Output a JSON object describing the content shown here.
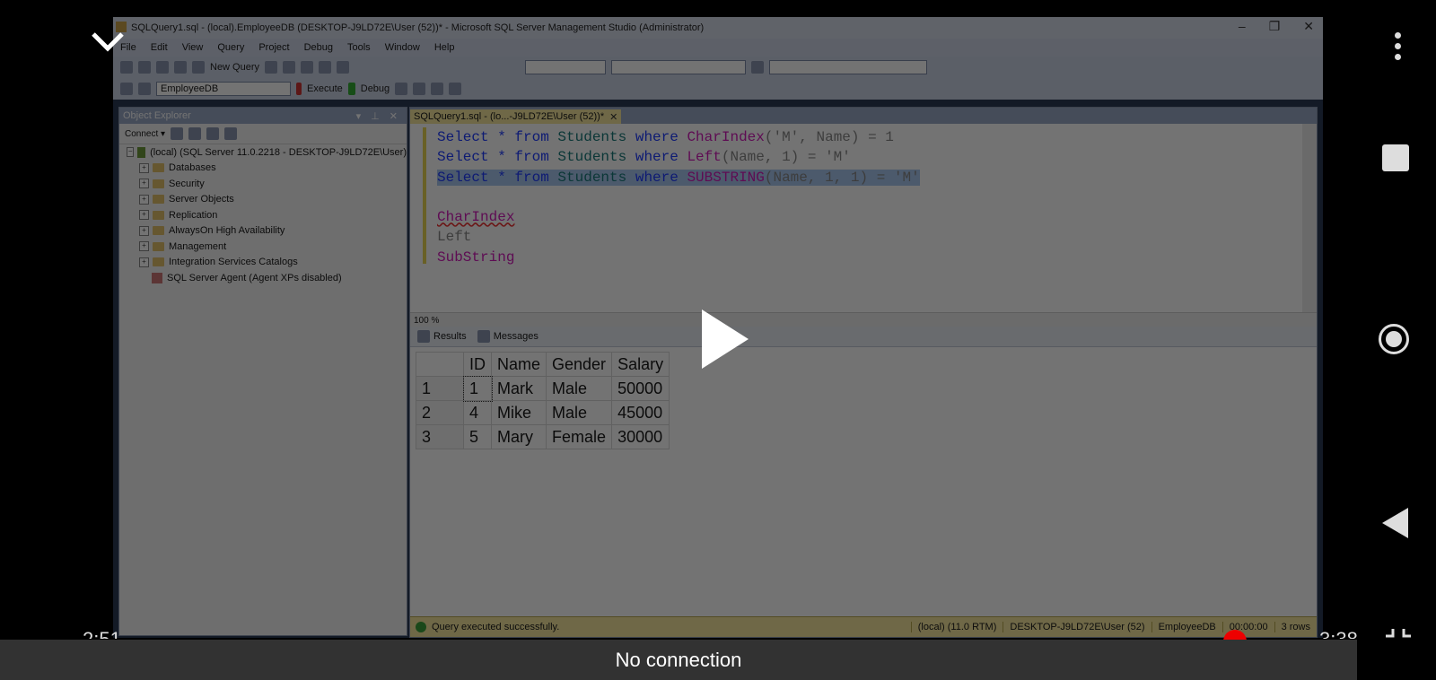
{
  "ssms": {
    "title": "SQLQuery1.sql - (local).EmployeeDB (DESKTOP-J9LD72E\\User (52))* - Microsoft SQL Server Management Studio (Administrator)",
    "window_controls": [
      "–",
      "❐",
      "✕"
    ],
    "menu": [
      "File",
      "Edit",
      "View",
      "Query",
      "Project",
      "Debug",
      "Tools",
      "Window",
      "Help"
    ],
    "toolbar1": {
      "new_query": "New Query"
    },
    "toolbar2": {
      "database": "EmployeeDB",
      "execute": "Execute",
      "debug": "Debug"
    },
    "object_explorer": {
      "title": "Object Explorer",
      "header_controls": "▾ ⊥ ✕",
      "connect": "Connect ▾",
      "server": "(local) (SQL Server 11.0.2218 - DESKTOP-J9LD72E\\User)",
      "nodes": [
        "Databases",
        "Security",
        "Server Objects",
        "Replication",
        "AlwaysOn High Availability",
        "Management",
        "Integration Services Catalogs"
      ],
      "agent": "SQL Server Agent (Agent XPs disabled)"
    },
    "doc_tab": {
      "label": "SQLQuery1.sql - (lo...-J9LD72E\\User (52))*",
      "close": "✕"
    },
    "code": {
      "line1": {
        "a": "Select * from ",
        "b": "Students",
        "c": " where ",
        "d": "CharIndex",
        "e": "('M', Name) = 1"
      },
      "line2": {
        "a": "Select * from ",
        "b": "Students",
        "c": " where ",
        "d": "Left",
        "e": "(Name, 1) = 'M'"
      },
      "line3": {
        "a": "Select * from ",
        "b": "Students",
        "c": " where ",
        "d": "SUBSTRING",
        "e": "(Name, 1, 1) = 'M'"
      },
      "line5": "CharIndex",
      "line6": "Left",
      "line7": "SubString"
    },
    "zoom": "100 %",
    "result_tabs": {
      "results": "Results",
      "messages": "Messages"
    },
    "results": {
      "columns": [
        "ID",
        "Name",
        "Gender",
        "Salary"
      ],
      "rows": [
        [
          "1",
          "1",
          "Mark",
          "Male",
          "50000"
        ],
        [
          "2",
          "4",
          "Mike",
          "Male",
          "45000"
        ],
        [
          "3",
          "5",
          "Mary",
          "Female",
          "30000"
        ]
      ]
    },
    "status": {
      "message": "Query executed successfully.",
      "server": "(local) (11.0 RTM)",
      "user": "DESKTOP-J9LD72E\\User (52)",
      "db": "EmployeeDB",
      "time": "00:00:00",
      "rows": "3 rows"
    }
  },
  "player": {
    "time_elapsed": "2:51",
    "time_total": "3:38",
    "snackbar": "No connection"
  },
  "colors": {
    "accent": "#ff0000",
    "snackbar_bg": "#323232"
  }
}
